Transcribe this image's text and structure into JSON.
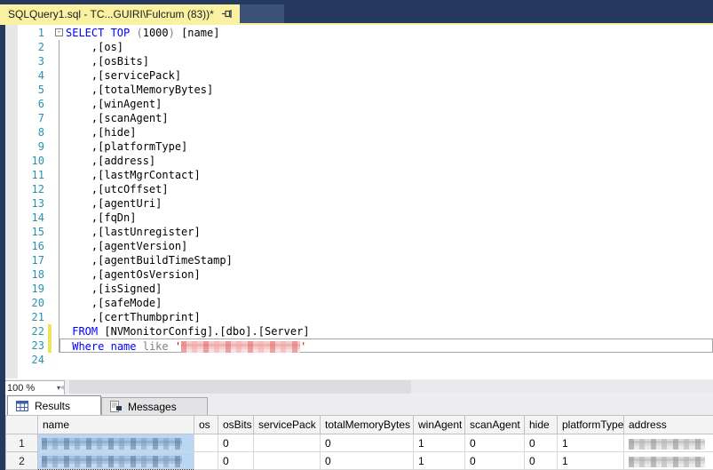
{
  "tab": {
    "title": "SQLQuery1.sql - TC...GUIRI\\Fulcrum (83))*",
    "close_glyph": "×"
  },
  "icons": [
    "pin-icon",
    "close-icon",
    "chevron-down-icon",
    "scroll-left-arrow-icon",
    "results-grid-icon",
    "messages-icon",
    "fold-collapse-icon"
  ],
  "colors": {
    "titlebar_blue": "#25395E",
    "active_tab_yellow": "#FAF2A2",
    "keyword_blue": "#0000FF",
    "line_number_teal": "#2B91AF",
    "string_red": "#EE0000",
    "operator_gray": "#808080",
    "change_bar_yellow": "#F0E25A",
    "selection_blue": "#B9D7F2"
  },
  "editor": {
    "zoom_value": "100 %",
    "scroll_left_glyph": "◂",
    "chevron_glyph": "▾",
    "fold_glyph": "-",
    "lines": [
      {
        "n": "1",
        "fold": "box",
        "changed": false,
        "current": false,
        "tokens": [
          {
            "c": "kw",
            "t": "SELECT TOP "
          },
          {
            "c": "gy",
            "t": "("
          },
          {
            "c": "tx",
            "t": "1000"
          },
          {
            "c": "gy",
            "t": ")"
          },
          {
            "c": "tx",
            "t": " [name]"
          }
        ]
      },
      {
        "n": "2",
        "fold": "line",
        "changed": false,
        "current": false,
        "tokens": [
          {
            "c": "tx",
            "t": "    ,[os]"
          }
        ]
      },
      {
        "n": "3",
        "fold": "line",
        "changed": false,
        "current": false,
        "tokens": [
          {
            "c": "tx",
            "t": "    ,[osBits]"
          }
        ]
      },
      {
        "n": "4",
        "fold": "line",
        "changed": false,
        "current": false,
        "tokens": [
          {
            "c": "tx",
            "t": "    ,[servicePack]"
          }
        ]
      },
      {
        "n": "5",
        "fold": "line",
        "changed": false,
        "current": false,
        "tokens": [
          {
            "c": "tx",
            "t": "    ,[totalMemoryBytes]"
          }
        ]
      },
      {
        "n": "6",
        "fold": "line",
        "changed": false,
        "current": false,
        "tokens": [
          {
            "c": "tx",
            "t": "    ,[winAgent]"
          }
        ]
      },
      {
        "n": "7",
        "fold": "line",
        "changed": false,
        "current": false,
        "tokens": [
          {
            "c": "tx",
            "t": "    ,[scanAgent]"
          }
        ]
      },
      {
        "n": "8",
        "fold": "line",
        "changed": false,
        "current": false,
        "tokens": [
          {
            "c": "tx",
            "t": "    ,[hide]"
          }
        ]
      },
      {
        "n": "9",
        "fold": "line",
        "changed": false,
        "current": false,
        "tokens": [
          {
            "c": "tx",
            "t": "    ,[platformType]"
          }
        ]
      },
      {
        "n": "10",
        "fold": "line",
        "changed": false,
        "current": false,
        "tokens": [
          {
            "c": "tx",
            "t": "    ,[address]"
          }
        ]
      },
      {
        "n": "11",
        "fold": "line",
        "changed": false,
        "current": false,
        "tokens": [
          {
            "c": "tx",
            "t": "    ,[lastMgrContact]"
          }
        ]
      },
      {
        "n": "12",
        "fold": "line",
        "changed": false,
        "current": false,
        "tokens": [
          {
            "c": "tx",
            "t": "    ,[utcOffset]"
          }
        ]
      },
      {
        "n": "13",
        "fold": "line",
        "changed": false,
        "current": false,
        "tokens": [
          {
            "c": "tx",
            "t": "    ,[agentUri]"
          }
        ]
      },
      {
        "n": "14",
        "fold": "line",
        "changed": false,
        "current": false,
        "tokens": [
          {
            "c": "tx",
            "t": "    ,[fqDn]"
          }
        ]
      },
      {
        "n": "15",
        "fold": "line",
        "changed": false,
        "current": false,
        "tokens": [
          {
            "c": "tx",
            "t": "    ,[lastUnregister]"
          }
        ]
      },
      {
        "n": "16",
        "fold": "line",
        "changed": false,
        "current": false,
        "tokens": [
          {
            "c": "tx",
            "t": "    ,[agentVersion]"
          }
        ]
      },
      {
        "n": "17",
        "fold": "line",
        "changed": false,
        "current": false,
        "tokens": [
          {
            "c": "tx",
            "t": "    ,[agentBuildTimeStamp]"
          }
        ]
      },
      {
        "n": "18",
        "fold": "line",
        "changed": false,
        "current": false,
        "tokens": [
          {
            "c": "tx",
            "t": "    ,[agentOsVersion]"
          }
        ]
      },
      {
        "n": "19",
        "fold": "line",
        "changed": false,
        "current": false,
        "tokens": [
          {
            "c": "tx",
            "t": "    ,[isSigned]"
          }
        ]
      },
      {
        "n": "20",
        "fold": "line",
        "changed": false,
        "current": false,
        "tokens": [
          {
            "c": "tx",
            "t": "    ,[safeMode]"
          }
        ]
      },
      {
        "n": "21",
        "fold": "line",
        "changed": false,
        "current": false,
        "tokens": [
          {
            "c": "tx",
            "t": "    ,[certThumbprint]"
          }
        ]
      },
      {
        "n": "22",
        "fold": "line",
        "changed": true,
        "current": false,
        "tokens": [
          {
            "c": "tx",
            "t": " "
          },
          {
            "c": "kw",
            "t": "FROM"
          },
          {
            "c": "tx",
            "t": " [NVMonitorConfig].[dbo].[Server]"
          }
        ]
      },
      {
        "n": "23",
        "fold": "line",
        "changed": true,
        "current": true,
        "tokens": [
          {
            "c": "tx",
            "t": " "
          },
          {
            "c": "kw",
            "t": "Where"
          },
          {
            "c": "tx",
            "t": " "
          },
          {
            "c": "kw",
            "t": "name"
          },
          {
            "c": "tx",
            "t": " "
          },
          {
            "c": "gy",
            "t": "like"
          },
          {
            "c": "tx",
            "t": " "
          },
          {
            "c": "st",
            "t": "'"
          },
          {
            "c": "redact",
            "t": ""
          },
          {
            "c": "st",
            "t": "'"
          }
        ]
      },
      {
        "n": "24",
        "fold": "none",
        "changed": false,
        "current": false,
        "tokens": []
      }
    ]
  },
  "results": {
    "tabs": [
      {
        "label": "Results"
      },
      {
        "label": "Messages"
      }
    ]
  },
  "grid": {
    "columns": [
      "name",
      "os",
      "osBits",
      "servicePack",
      "totalMemoryBytes",
      "winAgent",
      "scanAgent",
      "hide",
      "platformType",
      "address"
    ],
    "redacted_columns": {
      "name": "selected-blue",
      "address": "gray"
    },
    "rows": [
      {
        "num": "1",
        "values": [
          "",
          "",
          "0",
          "",
          "0",
          "1",
          "0",
          "0",
          "1",
          ""
        ]
      },
      {
        "num": "2",
        "values": [
          "",
          "",
          "0",
          "",
          "0",
          "1",
          "0",
          "0",
          "1",
          ""
        ]
      }
    ]
  }
}
